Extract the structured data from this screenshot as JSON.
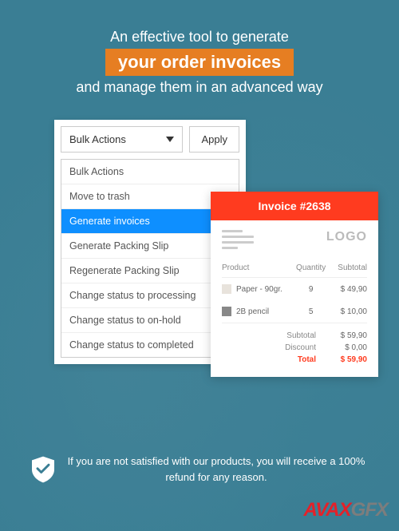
{
  "headline": {
    "line1": "An effective tool to generate",
    "highlight": "your order invoices",
    "line3": "and manage them in an advanced way"
  },
  "bulk": {
    "select_label": "Bulk Actions",
    "apply_label": "Apply",
    "options": [
      "Bulk Actions",
      "Move to trash",
      "Generate invoices",
      "Generate Packing Slip",
      "Regenerate Packing Slip",
      "Change status to processing",
      "Change status to on-hold",
      "Change status to completed"
    ],
    "selected_index": 2
  },
  "invoice": {
    "title": "Invoice #2638",
    "logo": "LOGO",
    "columns": {
      "product": "Product",
      "quantity": "Quantity",
      "subtotal": "Subtotal"
    },
    "rows": [
      {
        "name": "Paper - 90gr.",
        "qty": "9",
        "subtotal": "$ 49,90"
      },
      {
        "name": "2B pencil",
        "qty": "5",
        "subtotal": "$ 10,00"
      }
    ],
    "totals": {
      "subtotal_label": "Subtotal",
      "subtotal_value": "$ 59,90",
      "discount_label": "Discount",
      "discount_value": "$ 0,00",
      "total_label": "Total",
      "total_value": "$ 59,90"
    }
  },
  "guarantee": {
    "text": "If you are not satisfied with our products, you will receive a 100% refund for any reason."
  },
  "watermark": {
    "part1": "AVAX",
    "part2": "GFX"
  }
}
